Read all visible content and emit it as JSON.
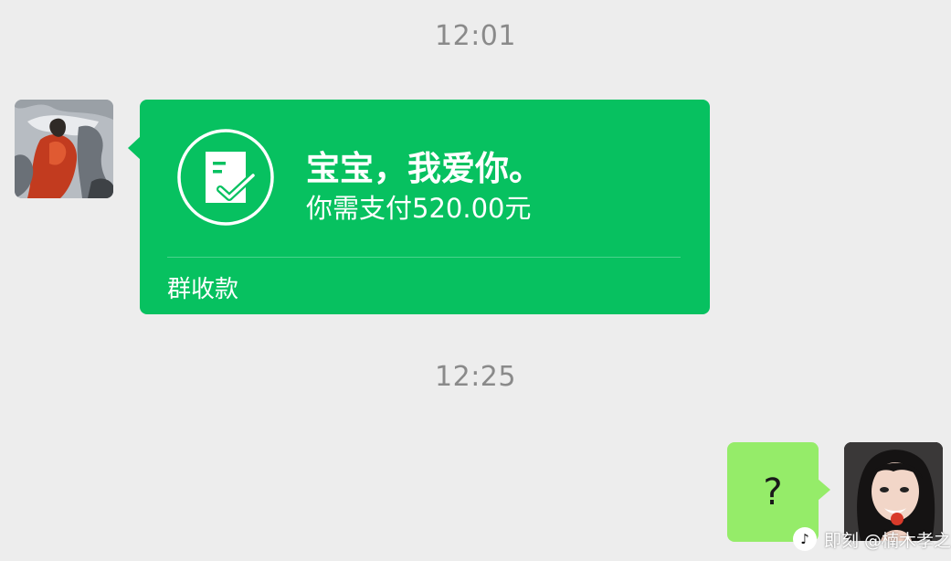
{
  "chat": {
    "timestamps": [
      "12:01",
      "12:25"
    ],
    "payment_card": {
      "title": "宝宝，我爱你。",
      "amount_text": "你需支付520.00元",
      "footer_label": "群收款",
      "icon": "receipt-check-icon",
      "background_color": "#07c160"
    },
    "sent_message": {
      "text": "?",
      "bubble_color": "#95ec69"
    },
    "avatars": {
      "left": "contact-avatar",
      "right": "user-avatar"
    }
  },
  "watermark": {
    "logo_icon": "jike-logo-icon",
    "text": "即刻 @楠木孝之"
  },
  "colors": {
    "chat_background": "#ededed",
    "timestamp_text": "#8a8a8a"
  }
}
